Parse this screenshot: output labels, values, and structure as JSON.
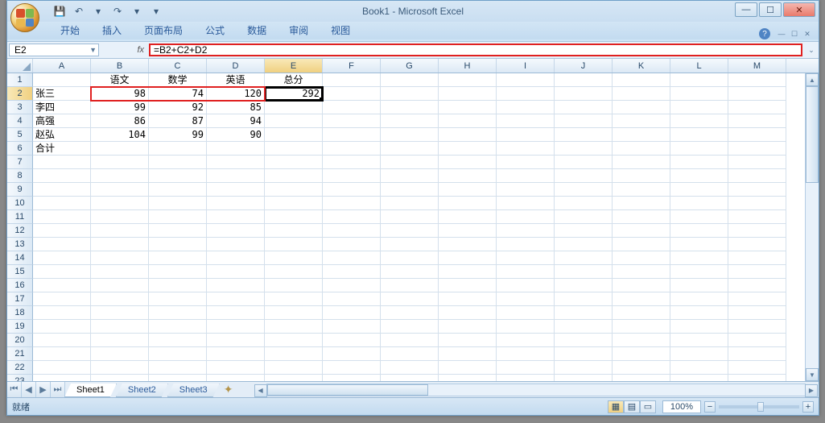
{
  "title": "Book1 - Microsoft Excel",
  "qat": {
    "save": "💾",
    "undo": "↶",
    "redo": "↷",
    "dd": "▾"
  },
  "win": {
    "min": "—",
    "max": "☐",
    "close": "✕"
  },
  "ribbon": {
    "tabs": [
      "开始",
      "插入",
      "页面布局",
      "公式",
      "数据",
      "审阅",
      "视图"
    ],
    "help": "?"
  },
  "namebox": "E2",
  "formula": "=B2+C2+D2",
  "columns": [
    "A",
    "B",
    "C",
    "D",
    "E",
    "F",
    "G",
    "H",
    "I",
    "J",
    "K",
    "L",
    "M"
  ],
  "active": {
    "col": "E",
    "row": 2
  },
  "cells": {
    "headers": {
      "B1": "语文",
      "C1": "数学",
      "D1": "英语",
      "E1": "总分"
    },
    "A2": "张三",
    "B2": "98",
    "C2": "74",
    "D2": "120",
    "E2": "292",
    "A3": "李四",
    "B3": "99",
    "C3": "92",
    "D3": "85",
    "A4": "高强",
    "B4": "86",
    "C4": "87",
    "D4": "94",
    "A5": "赵弘",
    "B5": "104",
    "C5": "99",
    "D5": "90",
    "A6": "合计"
  },
  "sheets": {
    "list": [
      "Sheet1",
      "Sheet2",
      "Sheet3"
    ],
    "active": "Sheet1",
    "nav": [
      "⏮",
      "◀",
      "▶",
      "⏭"
    ]
  },
  "status": {
    "ready": "就绪",
    "zoom": "100%",
    "minus": "−",
    "plus": "+"
  },
  "chart_data": {
    "type": "table",
    "categories": [
      "语文",
      "数学",
      "英语",
      "总分"
    ],
    "rows": [
      {
        "name": "张三",
        "values": [
          98,
          74,
          120,
          292
        ]
      },
      {
        "name": "李四",
        "values": [
          99,
          92,
          85,
          null
        ]
      },
      {
        "name": "高强",
        "values": [
          86,
          87,
          94,
          null
        ]
      },
      {
        "name": "赵弘",
        "values": [
          104,
          99,
          90,
          null
        ]
      },
      {
        "name": "合计",
        "values": [
          null,
          null,
          null,
          null
        ]
      }
    ]
  }
}
